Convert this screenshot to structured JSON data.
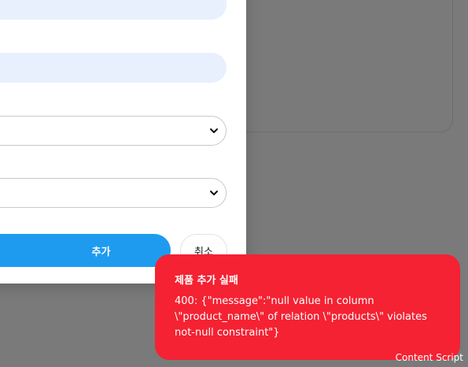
{
  "form": {
    "add_button_label": "추가",
    "cancel_button_label": "취소"
  },
  "toast": {
    "title": "제품 추가 실패",
    "message": "400: {\"message\":\"null value in column \\\"product_name\\\" of relation \\\"products\\\" violates not-null constraint\"}",
    "color": "#f42232"
  },
  "footer": {
    "content_script_label": "Content Script"
  },
  "colors": {
    "overlay": "#7a7a7a",
    "input_fill": "#e8f0fe",
    "primary_button": "#1e9bef"
  }
}
